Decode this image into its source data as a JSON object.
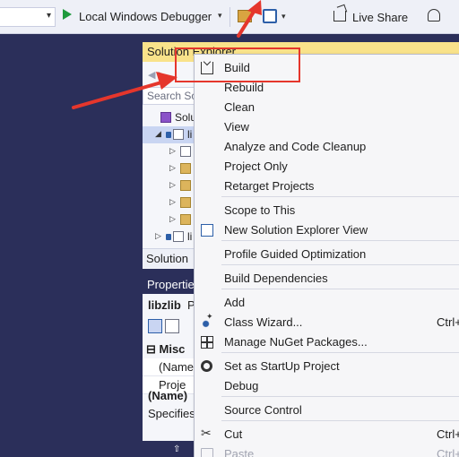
{
  "toolbar": {
    "run_label": "Local Windows Debugger",
    "share_label": "Live Share",
    "icons": [
      "play-icon",
      "chevron-down-icon",
      "folder-icon",
      "window-icon",
      "live-share-icon",
      "person-icon"
    ]
  },
  "solution_explorer": {
    "title": "Solution Explorer",
    "search_placeholder": "Search So",
    "nav_glyphs": "◀ ▶",
    "tree": [
      {
        "label": "Solu",
        "expand": "",
        "kind": "solution",
        "selected": false
      },
      {
        "label": "li",
        "expand": "◢",
        "kind": "project",
        "selected": true
      },
      {
        "label": "",
        "expand": "▷",
        "kind": "references",
        "selected": false
      },
      {
        "label": "",
        "expand": "▷",
        "kind": "folder",
        "selected": false
      },
      {
        "label": "",
        "expand": "▷",
        "kind": "folder",
        "selected": false
      },
      {
        "label": "",
        "expand": "▷",
        "kind": "folder",
        "selected": false
      },
      {
        "label": "",
        "expand": "▷",
        "kind": "folder",
        "selected": false
      },
      {
        "label": "li",
        "expand": "▷",
        "kind": "project",
        "selected": false
      }
    ],
    "footer_tab": "Solution"
  },
  "properties": {
    "title": "Properties",
    "object_name": "libzlib",
    "object_type": "P",
    "category": "Misc",
    "props": [
      "(Name",
      "Proje"
    ],
    "desc_name": "(Name)",
    "desc_text": "Specifies"
  },
  "status_glyph": "⇧",
  "context_menu": {
    "items": [
      {
        "label": "Build",
        "shortcut": "",
        "icon": "build-icon",
        "disabled": false
      },
      {
        "label": "Rebuild",
        "shortcut": "",
        "icon": "",
        "disabled": false
      },
      {
        "label": "Clean",
        "shortcut": "",
        "icon": "",
        "disabled": false
      },
      {
        "label": "View",
        "shortcut": "",
        "icon": "",
        "disabled": false
      },
      {
        "label": "Analyze and Code Cleanup",
        "shortcut": "",
        "icon": "",
        "disabled": false
      },
      {
        "label": "Project Only",
        "shortcut": "",
        "icon": "",
        "disabled": false
      },
      {
        "label": "Retarget Projects",
        "shortcut": "",
        "icon": "",
        "disabled": false
      },
      {
        "label": "Scope to This",
        "shortcut": "",
        "icon": "",
        "disabled": false
      },
      {
        "label": "New Solution Explorer View",
        "shortcut": "",
        "icon": "new-view-icon",
        "disabled": false
      },
      {
        "label": "Profile Guided Optimization",
        "shortcut": "",
        "icon": "",
        "disabled": false
      },
      {
        "label": "Build Dependencies",
        "shortcut": "",
        "icon": "",
        "disabled": false
      },
      {
        "label": "Add",
        "shortcut": "",
        "icon": "",
        "disabled": false
      },
      {
        "label": "Class Wizard...",
        "shortcut": "Ctrl+",
        "icon": "class-wizard-icon",
        "disabled": false
      },
      {
        "label": "Manage NuGet Packages...",
        "shortcut": "",
        "icon": "nuget-icon",
        "disabled": false
      },
      {
        "label": "Set as StartUp Project",
        "shortcut": "",
        "icon": "gear-icon",
        "disabled": false
      },
      {
        "label": "Debug",
        "shortcut": "",
        "icon": "",
        "disabled": false
      },
      {
        "label": "Source Control",
        "shortcut": "",
        "icon": "",
        "disabled": false
      },
      {
        "label": "Cut",
        "shortcut": "Ctrl+",
        "icon": "scissors-icon",
        "disabled": false
      },
      {
        "label": "Paste",
        "shortcut": "Ctrl+",
        "icon": "paste-icon",
        "disabled": true
      }
    ]
  },
  "annotation_color": "#e5362c"
}
